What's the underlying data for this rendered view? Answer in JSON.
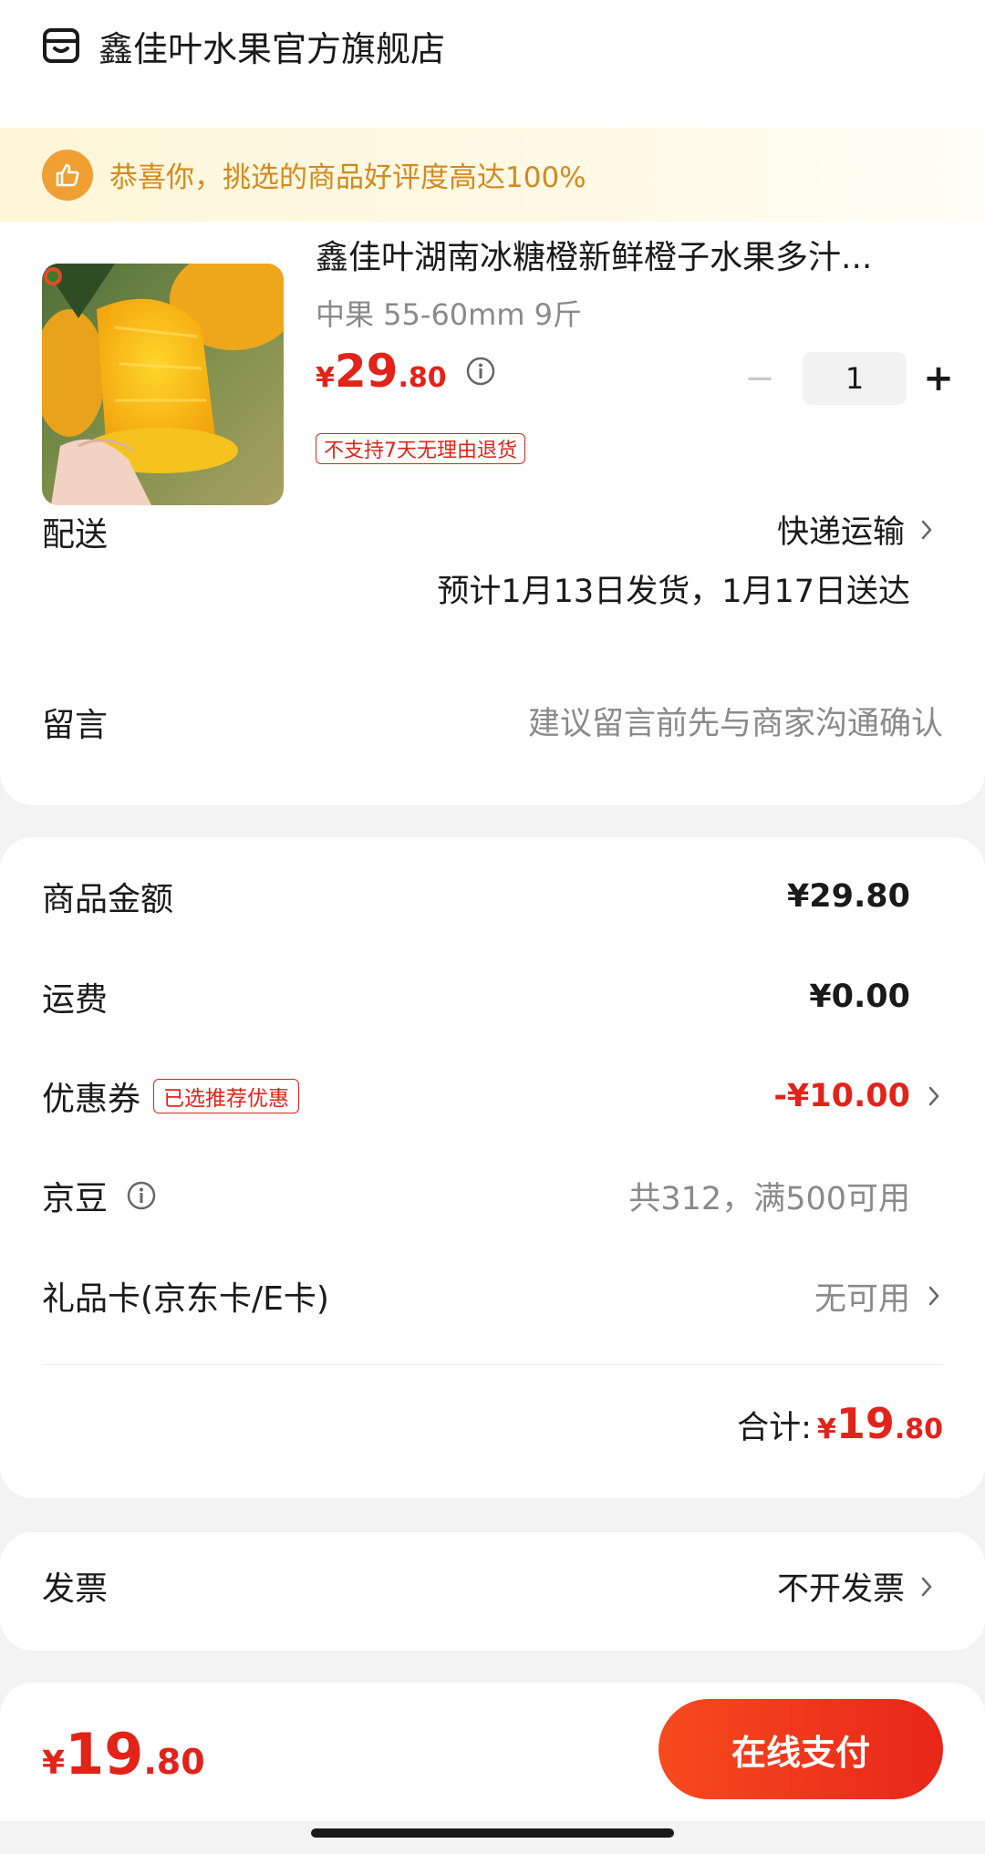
{
  "store": {
    "name": "鑫佳叶水果官方旗舰店",
    "icon": "store-icon"
  },
  "banner": {
    "text": "恭喜你，挑选的商品好评度高达100%",
    "icon": "thumbs-up-icon"
  },
  "product": {
    "title": "鑫佳叶湖南冰糖橙新鲜橙子水果多汁...",
    "spec": "中果 55-60mm 9斤",
    "price_symbol": "¥",
    "price_int": "29",
    "price_dec": ".80",
    "quantity": "1",
    "minus_label": "−",
    "plus_label": "+",
    "return_policy": "不支持7天无理由退货"
  },
  "delivery": {
    "label": "配送",
    "method": "快递运输",
    "eta": "预计1月13日发货，1月17日送达"
  },
  "message": {
    "label": "留言",
    "placeholder": "建议留言前先与商家沟通确认"
  },
  "summary": {
    "goods_label": "商品金额",
    "goods_value": "¥29.80",
    "shipping_label": "运费",
    "shipping_value": "¥0.00",
    "coupon_label": "优惠券",
    "coupon_badge": "已选推荐优惠",
    "coupon_value": "-¥10.00",
    "jingdou_label": "京豆",
    "jingdou_value": "共312，满500可用",
    "giftcard_label": "礼品卡(京东卡/E卡)",
    "giftcard_value": "无可用",
    "total_label": "合计:",
    "total_symbol": "¥",
    "total_int": "19",
    "total_dec": ".80"
  },
  "invoice": {
    "label": "发票",
    "value": "不开发票"
  },
  "bottom": {
    "price_symbol": "¥",
    "price_int": "19",
    "price_dec": ".80",
    "pay_label": "在线支付"
  },
  "colors": {
    "accent_red": "#e2231a",
    "banner_text": "#d28a1e",
    "banner_bg": "#fff6d9"
  }
}
